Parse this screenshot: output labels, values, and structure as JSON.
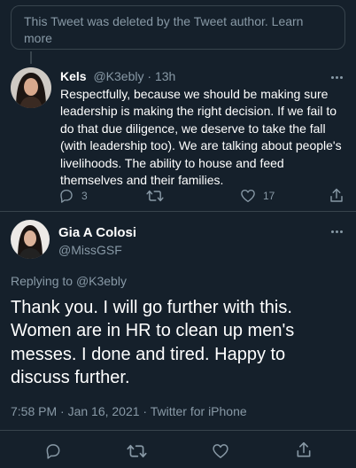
{
  "deleted_notice": {
    "text": "This Tweet was deleted by the Tweet author.",
    "learn_more": "Learn more"
  },
  "reply_tweet": {
    "name": "Kels",
    "handle": "@K3ebly",
    "time": "13h",
    "text": "Respectfully, because we should be making sure leadership is making the right decision. If we fail to do that due diligence, we deserve to take the fall (with leadership too). We are talking about people's livelihoods. The ability to house and feed themselves and their families.",
    "reply_count": "3",
    "like_count": "17"
  },
  "main_tweet": {
    "name": "Gia A Colosi",
    "handle": "@MissGSF",
    "replying_prefix": "Replying to",
    "replying_handle": "@K3ebly",
    "text": "Thank you. I will go further with this. Women are in HR to clean up men's messes.  I done and tired. Happy to discuss further.",
    "meta": "7:58 PM · Jan 16, 2021 · Twitter for iPhone"
  },
  "colors": {
    "background": "#15202b",
    "border": "#38444d",
    "secondary_text": "#8899a6",
    "primary_text": "#ffffff"
  },
  "icons": [
    "more-icon",
    "reply-icon",
    "retweet-icon",
    "like-icon",
    "share-icon"
  ]
}
